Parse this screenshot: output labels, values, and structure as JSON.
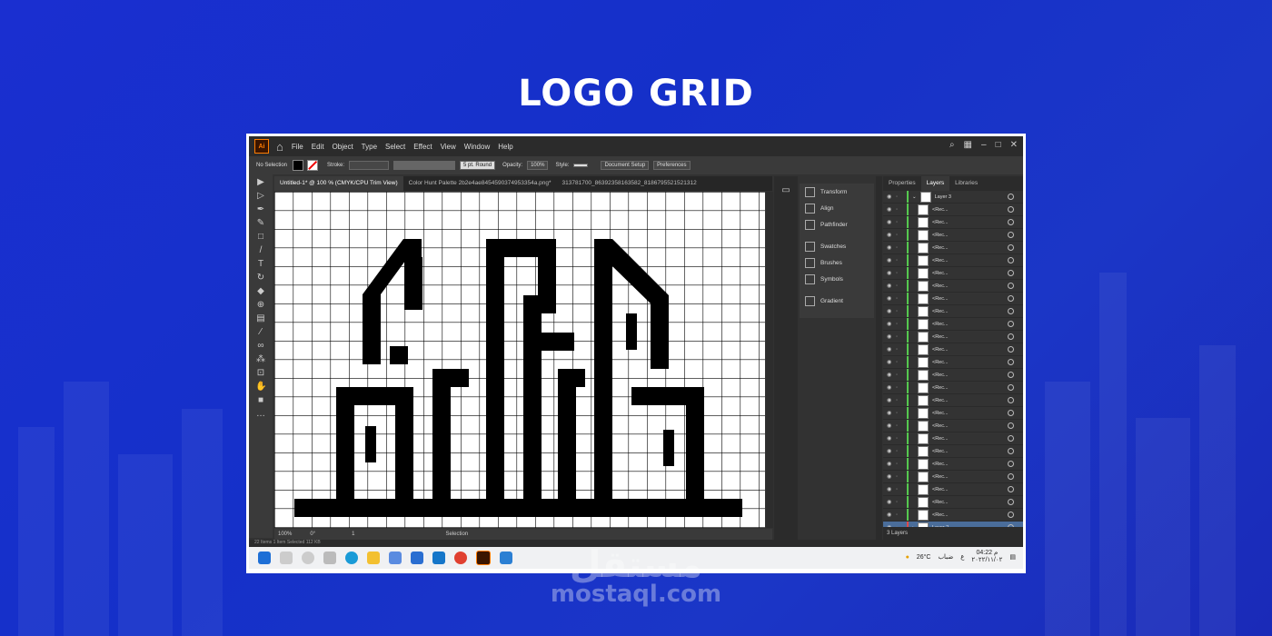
{
  "headline": "LOGO GRID",
  "app": {
    "logo": "Ai",
    "menu": [
      "File",
      "Edit",
      "Object",
      "Type",
      "Select",
      "Effect",
      "View",
      "Window",
      "Help"
    ],
    "control_bar": {
      "selection": "No Selection",
      "stroke_label": "Stroke:",
      "brush": "5 pt. Round",
      "opacity_label": "Opacity:",
      "opacity_value": "100%",
      "style_label": "Style:",
      "document_setup": "Document Setup",
      "preferences": "Preferences"
    },
    "tabs": [
      {
        "label": "Untitled-1* @ 100 % (CMYK/CPU Trim View)",
        "active": true
      },
      {
        "label": "Color Hunt Palette 2b2e4ae8454590374953354a.png*",
        "active": false
      },
      {
        "label": "313781700_86392358163582_8186795521521312",
        "active": false
      }
    ],
    "status": {
      "zoom": "100%",
      "rotation": "0°",
      "artboard": "1",
      "mode": "Selection",
      "items": "22 Items",
      "selected": "1 Item Selected",
      "size": "112 KB"
    },
    "panels": [
      "Transform",
      "Align",
      "Pathfinder",
      "Swatches",
      "Brushes",
      "Symbols",
      "Gradient"
    ],
    "layers_tabs": [
      "Properties",
      "Layers",
      "Libraries"
    ],
    "layers": {
      "top_layer": "Layer 3",
      "items_label": "<Rec...",
      "item_count": 25,
      "bottom_layer": "Layer 2",
      "footer": "3 Layers"
    },
    "taskbar": {
      "weather": "26°C",
      "weather_text": "ضباب",
      "time": "04:22 م",
      "date": "٢٠٢٢/١١/٠٢",
      "lang": "ع"
    }
  },
  "watermark": {
    "arabic": "مستقل",
    "latin": "mostaql.com"
  },
  "colors": {
    "background": "#1a2fd0",
    "accent_layer": "#55c84f",
    "ai_orange": "#ff7c00"
  }
}
